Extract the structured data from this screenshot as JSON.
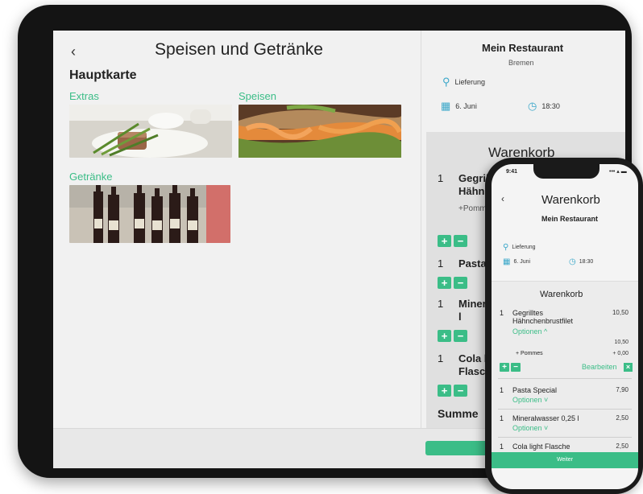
{
  "tablet": {
    "back": "‹",
    "title": "Speisen und Getränke",
    "menu_title": "Hauptkarte",
    "categories": [
      {
        "label": "Extras"
      },
      {
        "label": "Speisen"
      },
      {
        "label": "Getränke"
      }
    ],
    "restaurant": {
      "name": "Mein Restaurant",
      "city": "Bremen"
    },
    "delivery_label": "Lieferung",
    "date": "6. Juni",
    "time": "18:30",
    "cart": {
      "title": "Warenkorb",
      "items": [
        {
          "qty": "1",
          "name_line1": "Gegrilltes",
          "name_line2": "Hähnche",
          "sub": "+Pommes"
        },
        {
          "qty": "1",
          "name_line1": "Pasta Sp"
        },
        {
          "qty": "1",
          "name_line1": "Mineralw",
          "name_line2": "l"
        },
        {
          "qty": "1",
          "name_line1": "Cola light",
          "name_line2": "Flasche 0"
        }
      ],
      "sum_label": "Summe"
    }
  },
  "phone": {
    "time": "9:41",
    "status": "••• ▴ ▬",
    "back": "‹",
    "title": "Warenkorb",
    "restaurant": "Mein Restaurant",
    "delivery_label": "Lieferung",
    "date": "6. Juni",
    "time_slot": "18:30",
    "cart_title": "Warenkorb",
    "items": [
      {
        "qty": "1",
        "name": "Gegrilltes Hähnchenbrustfilet",
        "price": "10,50",
        "options": "Optionen ^"
      },
      {
        "qty": "1",
        "name": "Pasta Special",
        "price": "7,90",
        "options": "Optionen ˅"
      },
      {
        "qty": "1",
        "name": "Mineralwasser 0,25 l",
        "price": "2,50",
        "options": "Optionen ˅"
      },
      {
        "qty": "1",
        "name": "Cola light Flasche",
        "price": "2,50"
      }
    ],
    "sub_price": "10,50",
    "extra_name": "+ Pommes",
    "extra_price": "+ 0,00",
    "edit_label": "Bearbeiten",
    "weiter_label": "Weiter"
  },
  "colors": {
    "accent": "#3bbd87"
  }
}
